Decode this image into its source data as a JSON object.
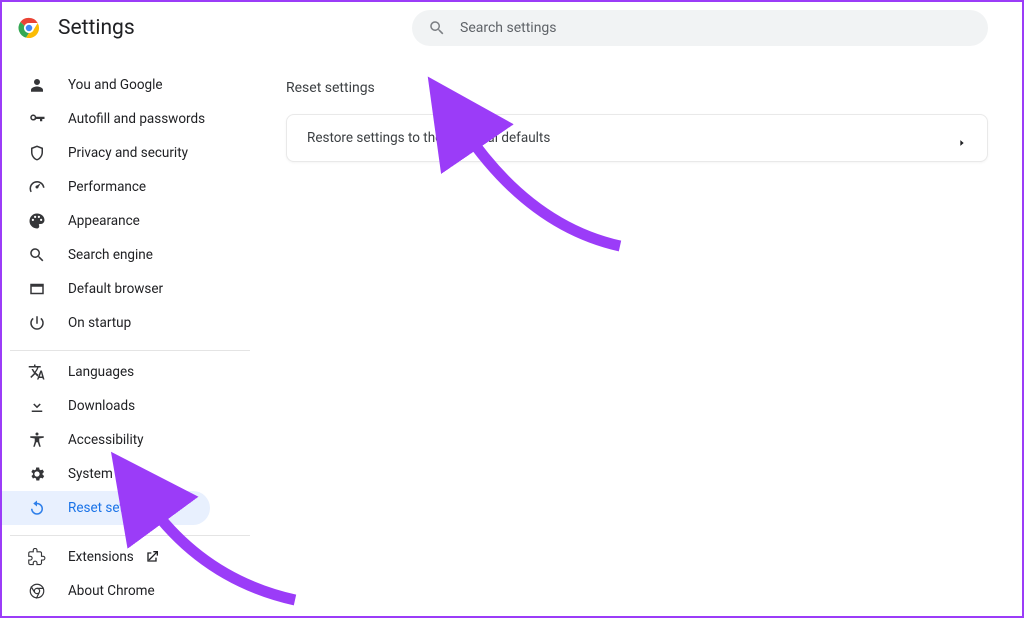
{
  "header": {
    "app_title": "Settings",
    "search_placeholder": "Search settings"
  },
  "sidebar": {
    "group1": [
      {
        "icon": "person-icon",
        "label": "You and Google"
      },
      {
        "icon": "key-icon",
        "label": "Autofill and passwords"
      },
      {
        "icon": "shield-icon",
        "label": "Privacy and security"
      },
      {
        "icon": "speedometer-icon",
        "label": "Performance"
      },
      {
        "icon": "appearance-icon",
        "label": "Appearance"
      },
      {
        "icon": "search-icon",
        "label": "Search engine"
      },
      {
        "icon": "browser-icon",
        "label": "Default browser"
      },
      {
        "icon": "power-icon",
        "label": "On startup"
      }
    ],
    "group2": [
      {
        "icon": "translate-icon",
        "label": "Languages"
      },
      {
        "icon": "download-icon",
        "label": "Downloads"
      },
      {
        "icon": "accessibility-icon",
        "label": "Accessibility"
      },
      {
        "icon": "system-icon",
        "label": "System"
      },
      {
        "icon": "reset-icon",
        "label": "Reset settings",
        "active": true
      }
    ],
    "group3": [
      {
        "icon": "extension-icon",
        "label": "Extensions",
        "external": true
      },
      {
        "icon": "chrome-icon",
        "label": "About Chrome"
      }
    ]
  },
  "main": {
    "section_title": "Reset settings",
    "rows": [
      {
        "label": "Restore settings to their original defaults"
      }
    ]
  }
}
